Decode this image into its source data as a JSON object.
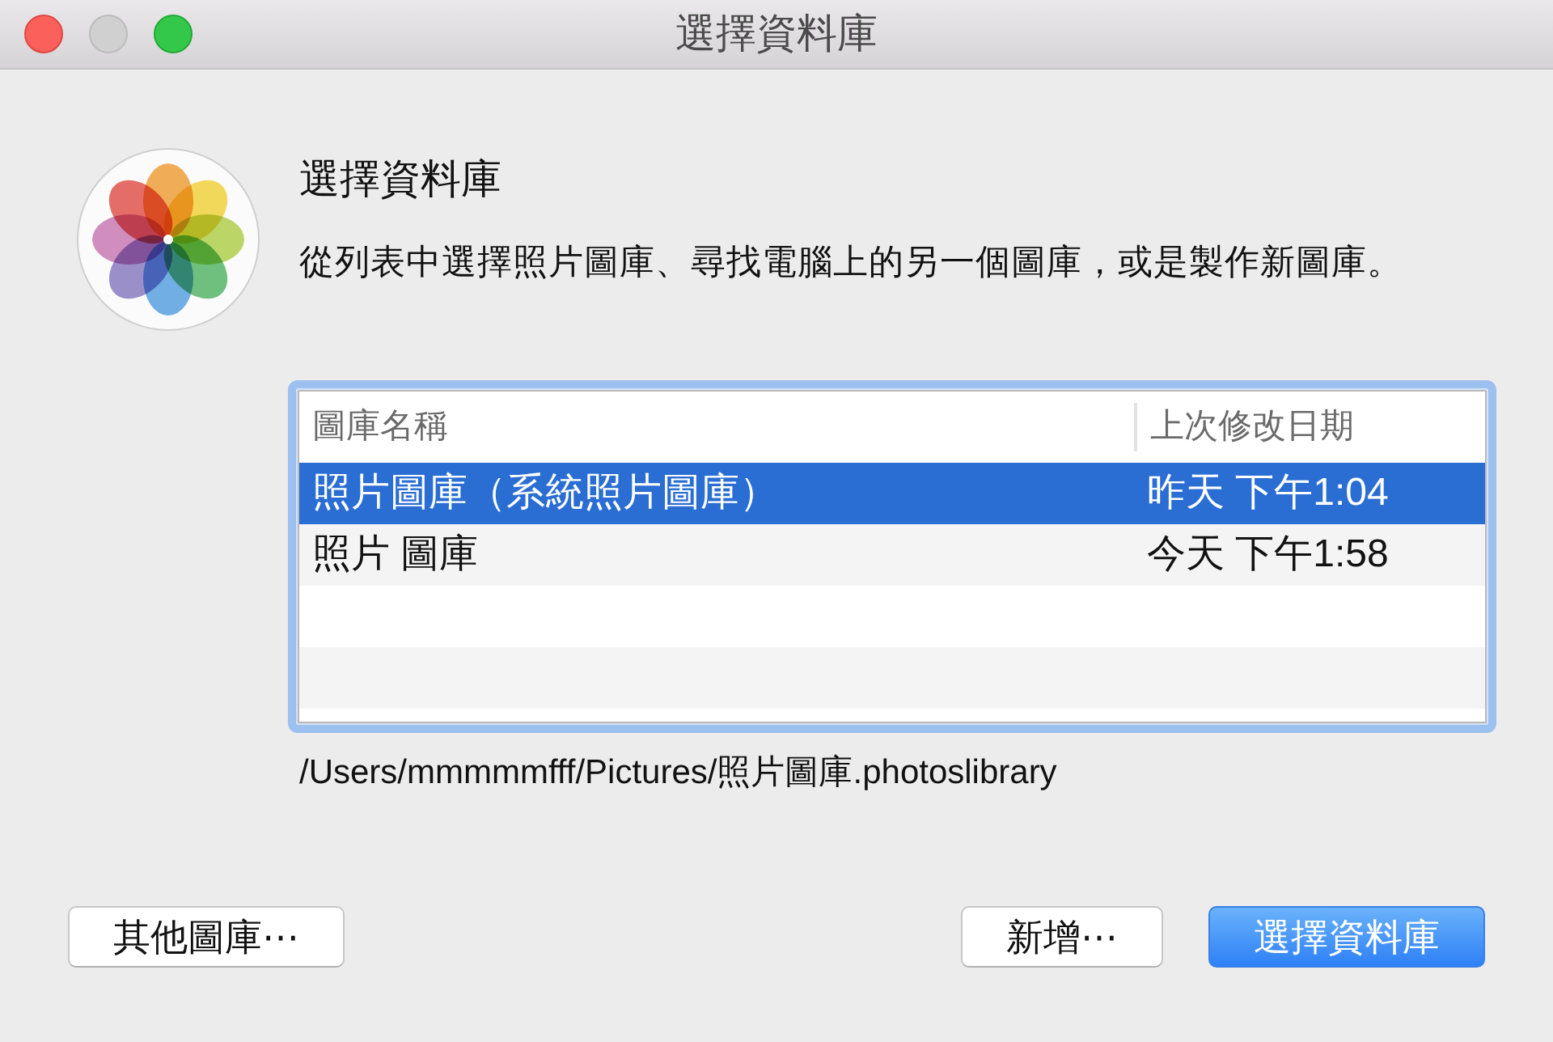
{
  "window": {
    "title": "選擇資料庫",
    "controls": [
      {
        "kind": "close",
        "disabled": false
      },
      {
        "kind": "minimize",
        "disabled": true
      },
      {
        "kind": "zoom",
        "disabled": false
      }
    ]
  },
  "dialog": {
    "heading": "選擇資料庫",
    "description": "從列表中選擇照片圖庫、尋找電腦上的另一個圖庫，或是製作新圖庫。"
  },
  "library_table": {
    "focused": true,
    "columns": [
      "圖庫名稱",
      "上次修改日期"
    ],
    "rows": [
      {
        "name": "照片圖庫（系統照片圖庫）",
        "modified": "昨天 下午1:04",
        "selected": true
      },
      {
        "name": "照片 圖庫",
        "modified": "今天 下午1:58",
        "selected": false
      }
    ]
  },
  "library_path": "/Users/mmmmmfff/Pictures/照片圖庫.photoslibrary",
  "footer": {
    "left_buttons": [
      {
        "label": "其他圖庫⋯",
        "kind": "default"
      }
    ],
    "right_buttons": [
      {
        "label": "新增⋯",
        "kind": "default"
      },
      {
        "label": "選擇資料庫",
        "kind": "primary"
      }
    ]
  }
}
